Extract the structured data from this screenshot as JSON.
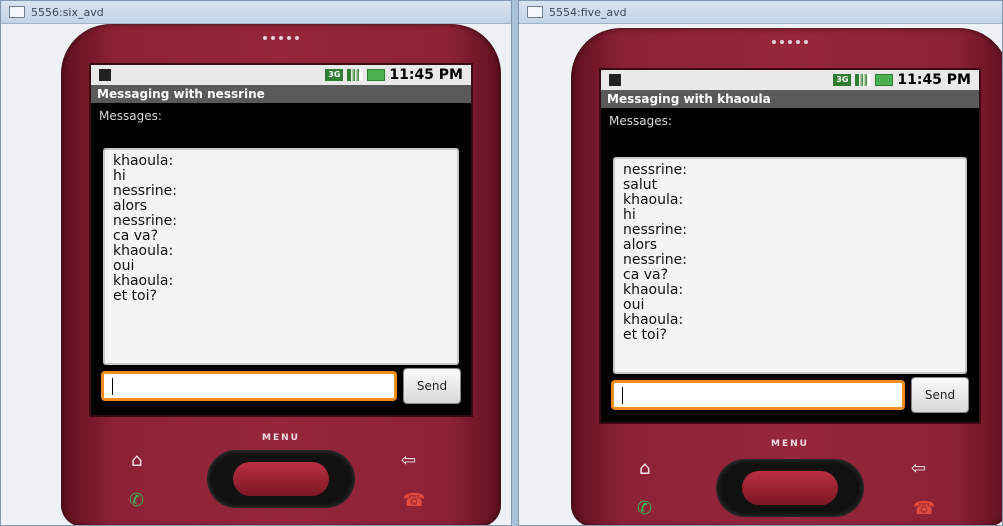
{
  "emulators": [
    {
      "window_title": "5556:six_avd",
      "status": {
        "time": "11:45 PM",
        "network": "3G"
      },
      "app_title": "Messaging with nessrine",
      "messages_label": "Messages:",
      "messages": [
        "khaoula:",
        "hi",
        "nessrine:",
        "alors",
        "nessrine:",
        "ca va?",
        "khaoula:",
        "oui",
        "khaoula:",
        "et toi?"
      ],
      "compose": {
        "value": "",
        "placeholder": ""
      },
      "send_label": "Send",
      "menu_label": "MENU",
      "icons": [
        "home-icon",
        "back-icon",
        "call-icon",
        "end-call-icon"
      ]
    },
    {
      "window_title": "5554:five_avd",
      "status": {
        "time": "11:45 PM",
        "network": "3G"
      },
      "app_title": "Messaging with khaoula",
      "messages_label": "Messages:",
      "messages": [
        "nessrine:",
        "salut",
        "khaoula:",
        "hi",
        "nessrine:",
        "alors",
        "nessrine:",
        "ca va?",
        "khaoula:",
        "oui",
        "khaoula:",
        "et toi?"
      ],
      "compose": {
        "value": "",
        "placeholder": ""
      },
      "send_label": "Send",
      "menu_label": "MENU",
      "icons": [
        "home-icon",
        "back-icon",
        "call-icon",
        "end-call-icon"
      ]
    }
  ],
  "colors": {
    "phone_body": "#8c2135",
    "input_focus": "#f28c1a",
    "desktop": "#a9c1d6"
  }
}
